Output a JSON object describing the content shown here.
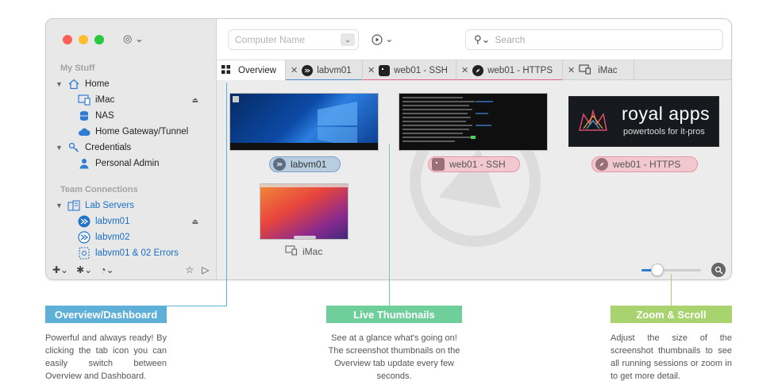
{
  "sidebar": {
    "section_my_stuff": "My Stuff",
    "home": "Home",
    "imac": "iMac",
    "nas": "NAS",
    "gateway": "Home Gateway/Tunnel",
    "credentials": "Credentials",
    "personal_admin": "Personal Admin",
    "section_team": "Team Connections",
    "lab_servers": "Lab Servers",
    "labvm01": "labvm01",
    "labvm02": "labvm02",
    "labvm_errors": "labvm01 & 02 Errors"
  },
  "toolbar": {
    "computer_name_placeholder": "Computer Name",
    "search_placeholder": "Search"
  },
  "tabs": [
    {
      "label": "Overview"
    },
    {
      "label": "labvm01"
    },
    {
      "label": "web01 - SSH"
    },
    {
      "label": "web01 - HTTPS"
    },
    {
      "label": "iMac"
    }
  ],
  "thumbnails": {
    "labvm01": "labvm01",
    "ssh": "web01 - SSH",
    "https": "web01 - HTTPS",
    "imac": "iMac",
    "royal_title": "royal apps",
    "royal_tagline": "powertools for it-pros"
  },
  "zoom": {
    "level": 0.2
  },
  "callouts": [
    {
      "title": "Overview/Dashboard",
      "text": "Powerful and always ready! By clicking the tab icon you can easily switch between Overview and Dashboard.",
      "color": "#5fb0d8"
    },
    {
      "title": "Live Thumbnails",
      "text": "See at a glance what's going on! The screenshot thumbnails on the Overview tab update every few seconds.",
      "color": "#6fcf9b"
    },
    {
      "title": "Zoom & Scroll",
      "text": "Adjust the size of the screenshot thumbnails to see all running sessions or zoom in to get more detail.",
      "color": "#a8d36f"
    }
  ]
}
